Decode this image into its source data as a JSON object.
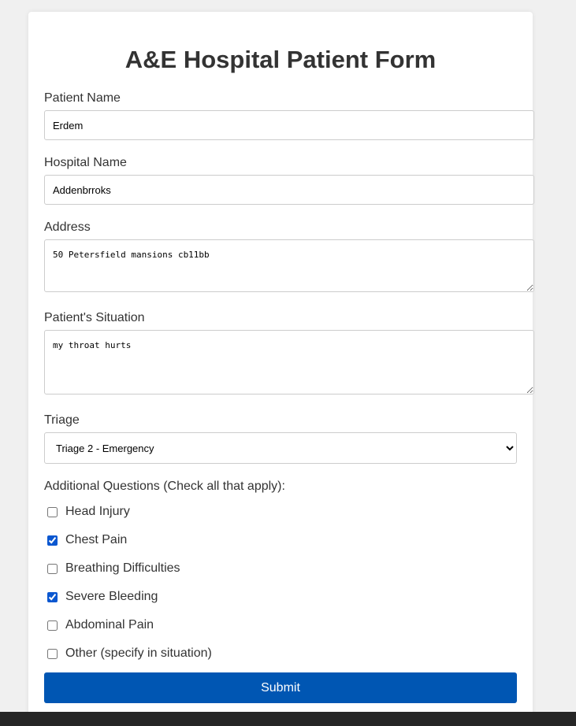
{
  "form": {
    "title": "A&E Hospital Patient Form",
    "patient_name": {
      "label": "Patient Name",
      "value": "Erdem"
    },
    "hospital_name": {
      "label": "Hospital Name",
      "value": "Addenbrroks"
    },
    "address": {
      "label": "Address",
      "value": "50 Petersfield mansions cb11bb"
    },
    "situation": {
      "label": "Patient's Situation",
      "value": "my throat hurts"
    },
    "triage": {
      "label": "Triage",
      "selected": "Triage 2 - Emergency"
    },
    "questions": {
      "label": "Additional Questions (Check all that apply):",
      "items": [
        {
          "label": "Head Injury",
          "checked": false
        },
        {
          "label": "Chest Pain",
          "checked": true
        },
        {
          "label": "Breathing Difficulties",
          "checked": false
        },
        {
          "label": "Severe Bleeding",
          "checked": true
        },
        {
          "label": "Abdominal Pain",
          "checked": false
        },
        {
          "label": "Other (specify in situation)",
          "checked": false
        }
      ]
    },
    "submit_label": "Submit"
  },
  "colors": {
    "background": "#f0f0f0",
    "card": "#ffffff",
    "submit_button": "#0056b3",
    "checkbox_accent": "#0b57d0",
    "taskbar": "#262626"
  }
}
